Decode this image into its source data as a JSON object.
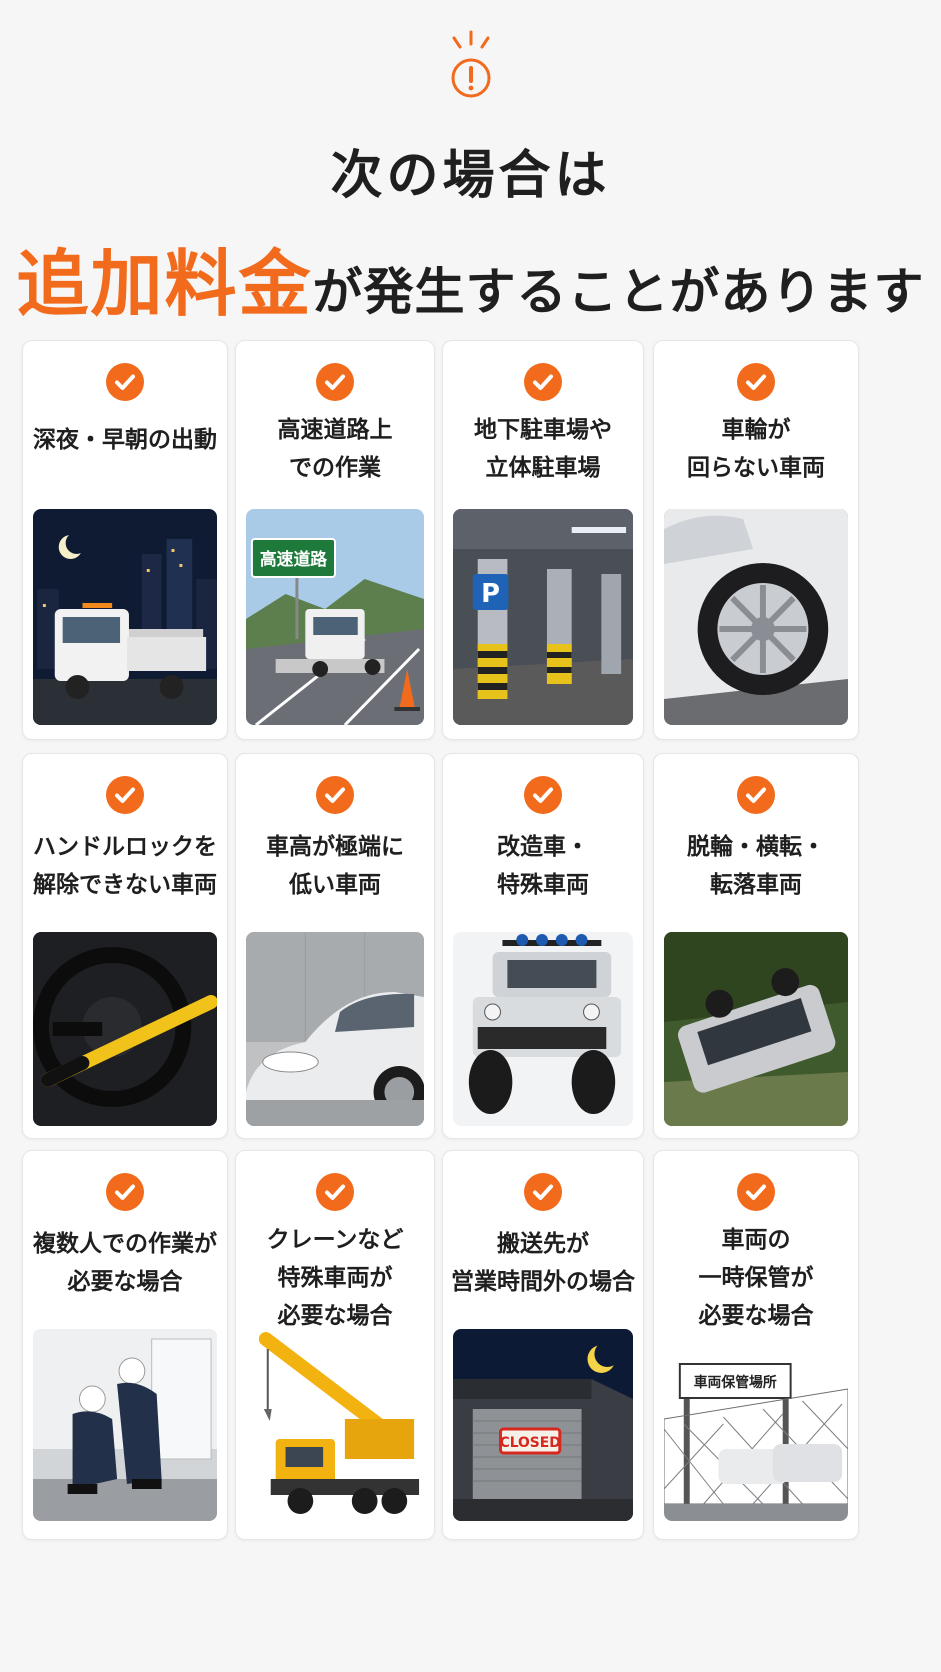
{
  "header": {
    "title_line1": "次の場合は",
    "title_accent": "追加料金",
    "title_rest": "が発生することがあります"
  },
  "colors": {
    "accent": "#f26a1b",
    "text": "#1f1f1f",
    "background": "#f6f6f6",
    "card": "#ffffff"
  },
  "cards": [
    {
      "label": "深夜・早朝の出動",
      "icon": "check-icon",
      "photo": "night-tow-truck"
    },
    {
      "label": "高速道路上\nでの作業",
      "icon": "check-icon",
      "photo": "highway-tow-truck",
      "sign_text": "高速道路"
    },
    {
      "label": "地下駐車場や\n立体駐車場",
      "icon": "check-icon",
      "photo": "underground-parking",
      "sign_text": "P"
    },
    {
      "label": "車輪が\n回らない車両",
      "icon": "check-icon",
      "photo": "car-wheel"
    },
    {
      "label": "ハンドルロックを\n解除できない車両",
      "icon": "check-icon",
      "photo": "steering-lock"
    },
    {
      "label": "車高が極端に\n低い車両",
      "icon": "check-icon",
      "photo": "lowered-sports-car"
    },
    {
      "label": "改造車・\n特殊車両",
      "icon": "check-icon",
      "photo": "modified-offroad-vehicle"
    },
    {
      "label": "脱輪・横転・\n転落車両",
      "icon": "check-icon",
      "photo": "overturned-car"
    },
    {
      "label": "複数人での作業が\n必要な場合",
      "icon": "check-icon",
      "photo": "workers-at-truck"
    },
    {
      "label": "クレーンなど\n特殊車両が\n必要な場合",
      "icon": "check-icon",
      "photo": "crane-truck"
    },
    {
      "label": "搬送先が\n営業時間外の場合",
      "icon": "check-icon",
      "photo": "closed-garage",
      "sign_text": "CLOSED"
    },
    {
      "label": "車両の\n一時保管が\n必要な場合",
      "icon": "check-icon",
      "photo": "vehicle-storage-yard",
      "sign_text": "車両保管場所"
    }
  ]
}
